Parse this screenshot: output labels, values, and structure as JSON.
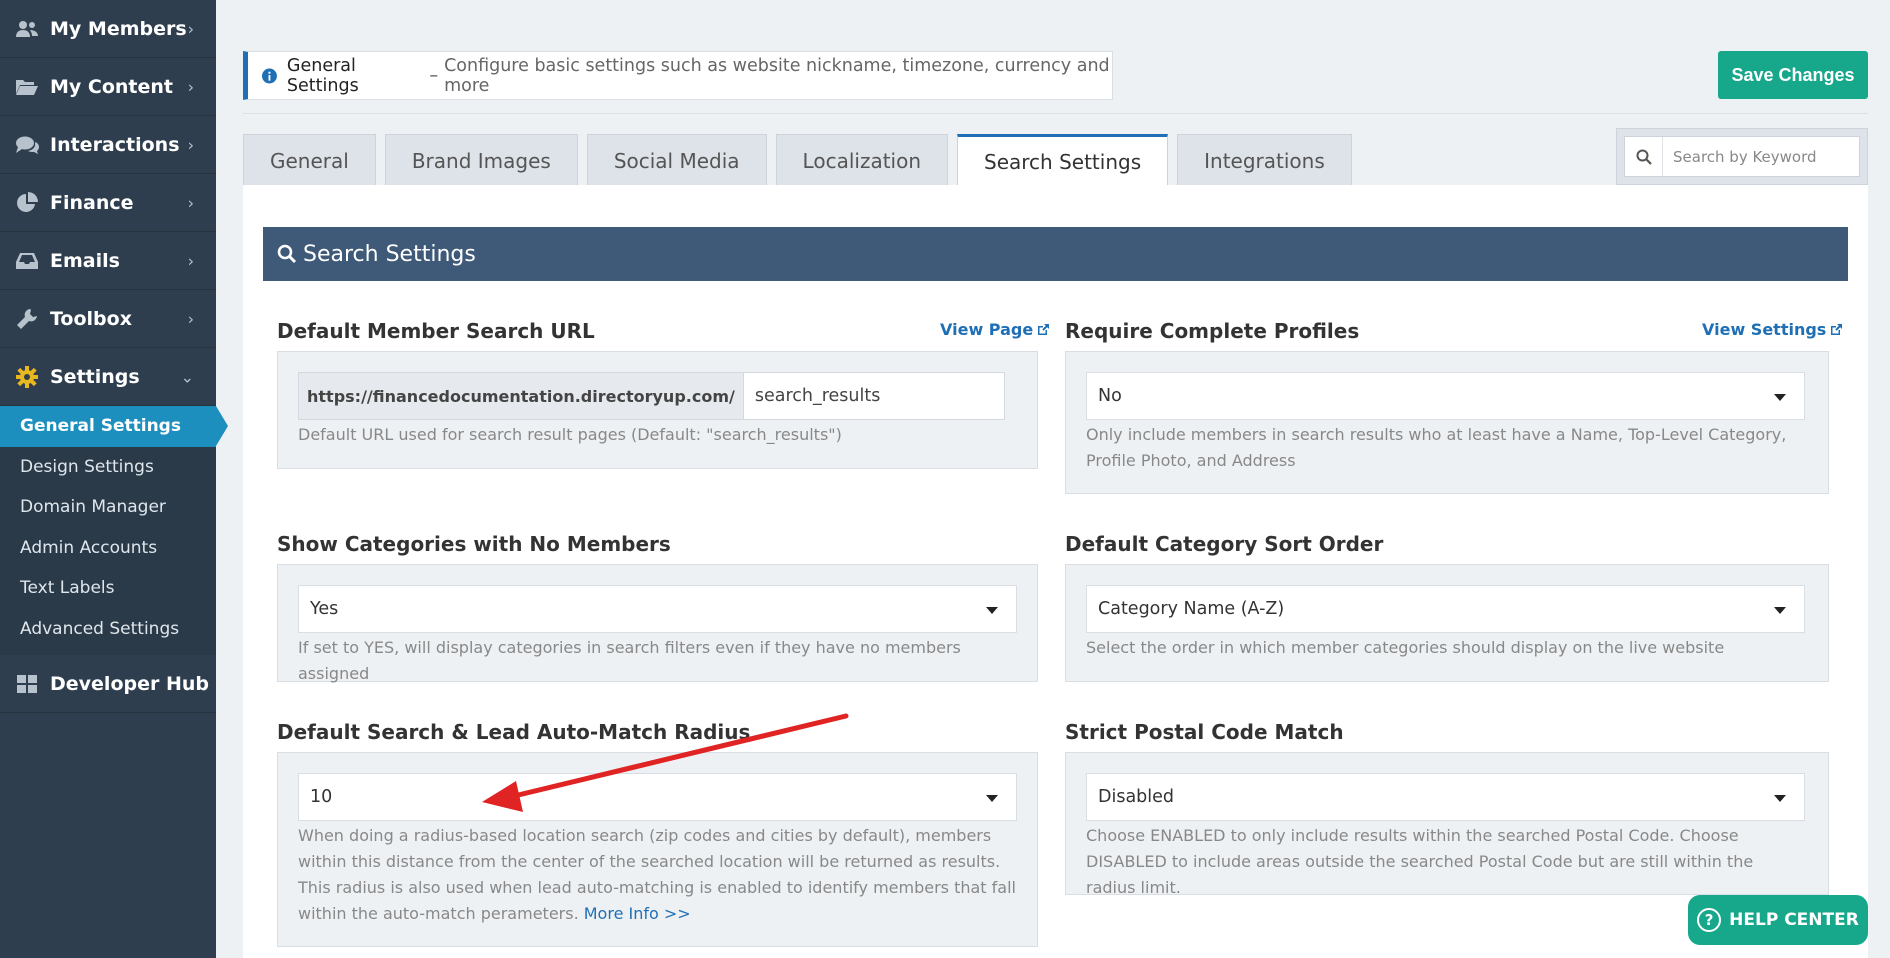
{
  "sidebar": {
    "items": [
      {
        "label": "My Members",
        "icon": "users-icon"
      },
      {
        "label": "My Content",
        "icon": "folder-open-icon"
      },
      {
        "label": "Interactions",
        "icon": "comments-icon"
      },
      {
        "label": "Finance",
        "icon": "pie-chart-icon"
      },
      {
        "label": "Emails",
        "icon": "inbox-icon"
      },
      {
        "label": "Toolbox",
        "icon": "wrench-icon"
      },
      {
        "label": "Settings",
        "icon": "gear-icon"
      }
    ],
    "settings_sub": [
      {
        "label": "General Settings",
        "active": true
      },
      {
        "label": "Design Settings"
      },
      {
        "label": "Domain Manager"
      },
      {
        "label": "Admin Accounts"
      },
      {
        "label": "Text Labels"
      },
      {
        "label": "Advanced Settings"
      }
    ],
    "developer_hub": "Developer Hub"
  },
  "header": {
    "title": "General Settings",
    "dash": "–",
    "description": "Configure basic settings such as website nickname, timezone, currency and more",
    "save_label": "Save Changes"
  },
  "tabs": [
    {
      "label": "General"
    },
    {
      "label": "Brand Images"
    },
    {
      "label": "Social Media"
    },
    {
      "label": "Localization"
    },
    {
      "label": "Search Settings",
      "active": true
    },
    {
      "label": "Integrations"
    }
  ],
  "search": {
    "placeholder": "Search by Keyword"
  },
  "section": {
    "title": "Search Settings"
  },
  "fields": {
    "member_search_url": {
      "label": "Default Member Search URL",
      "link": "View Page",
      "prefix": "https://financedocumentation.directoryup.com/",
      "value": "search_results",
      "help": "Default URL used for search result pages (Default: \"search_results\")"
    },
    "complete_profiles": {
      "label": "Require Complete Profiles",
      "link": "View Settings",
      "value": "No",
      "help": "Only include members in search results who at least have a Name, Top-Level Category, Profile Photo, and Address"
    },
    "show_categories": {
      "label": "Show Categories with No Members",
      "value": "Yes",
      "help": "If set to YES, will display categories in search filters even if they have no members assigned"
    },
    "category_sort": {
      "label": "Default Category Sort Order",
      "value": "Category Name (A-Z)",
      "help": "Select the order in which member categories should display on the live website"
    },
    "radius": {
      "label": "Default Search & Lead Auto-Match Radius",
      "value": "10",
      "help": "When doing a radius-based location search (zip codes and cities by default), members within this distance from the center of the searched location will be returned as results. This radius is also used when lead auto-matching is enabled to identify members that fall within the auto-match perameters.",
      "more": "More Info >>"
    },
    "postal_match": {
      "label": "Strict Postal Code Match",
      "value": "Disabled",
      "help": "Choose ENABLED to only include results within the searched Postal Code. Choose DISABLED to include areas outside the searched Postal Code but are still within the radius limit."
    }
  },
  "help_center": "HELP CENTER",
  "colors": {
    "sidebar": "#2e3e4e",
    "active": "#1d8fbf",
    "save": "#17a78b",
    "section_header": "#3f5a78",
    "link": "#1f6fb5",
    "annotation_arrow": "#e02424"
  }
}
